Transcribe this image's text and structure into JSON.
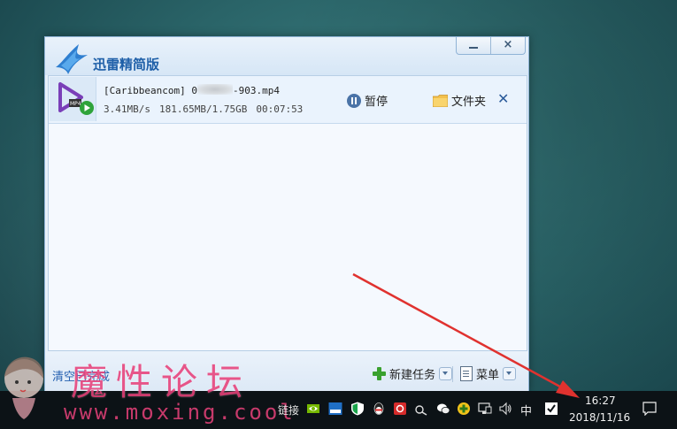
{
  "window": {
    "title": "迅雷精简版",
    "minimize_symbol": "",
    "close_symbol": "×"
  },
  "task": {
    "file_name_prefix": "[Caribbeancom] 0",
    "file_name_suffix": "-903.mp4",
    "speed": "3.41MB/s",
    "size_progress": "181.65MB/1.75GB",
    "time_left": "00:07:53",
    "pause_label": "暂停",
    "folder_label": "文件夹",
    "delete_symbol": "✕"
  },
  "bottom_bar": {
    "clear_label": "清空已完成",
    "new_task_label": "新建任务",
    "menu_label": "菜单"
  },
  "watermark": {
    "text": "魔性论坛",
    "url": "www.moxing.cool"
  },
  "taskbar": {
    "links_label": "链接",
    "ime_label": "中",
    "time": "16:27",
    "date": "2018/11/16"
  },
  "colors": {
    "accent": "#1e5fa8",
    "arrow": "#e0322f",
    "watermark": "#e8417a"
  }
}
